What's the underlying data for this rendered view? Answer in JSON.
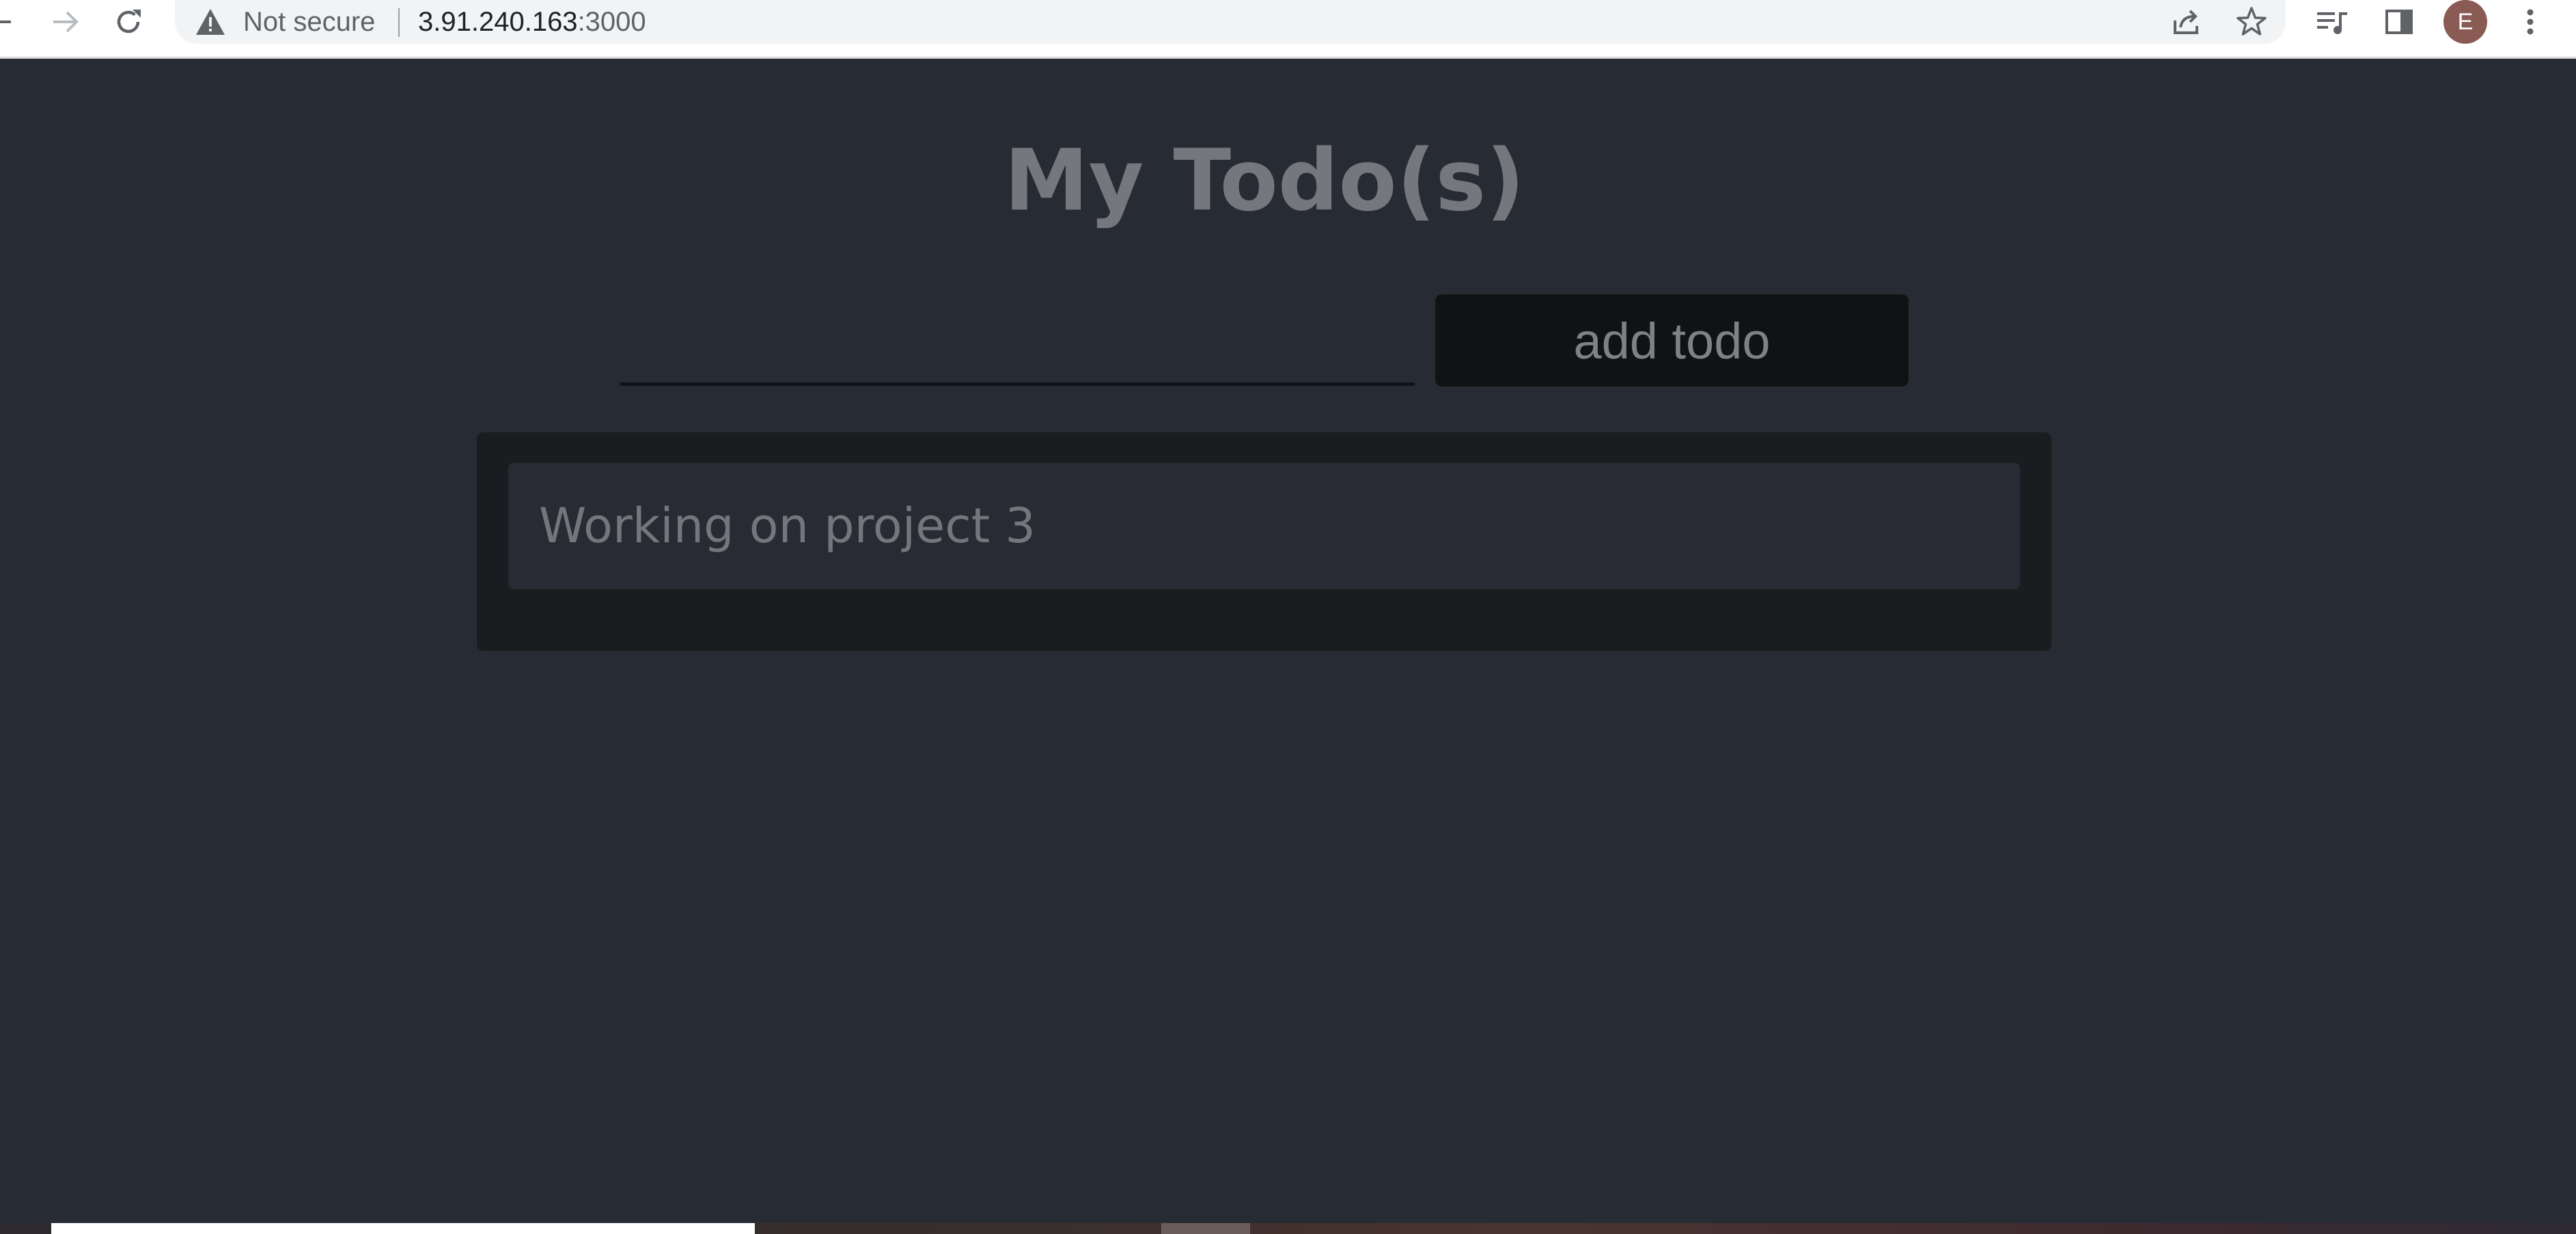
{
  "browser": {
    "security_label": "Not secure",
    "url_host": "3.91.240.163",
    "url_port": ":3000",
    "profile_initial": "E"
  },
  "page": {
    "title": "My Todo(s)",
    "input_value": "",
    "add_button_label": "add todo",
    "todos": [
      {
        "text": "Working on project 3"
      }
    ]
  },
  "icons": {
    "back": "back-arrow-icon",
    "forward": "forward-arrow-icon",
    "reload": "reload-icon",
    "warning": "warning-triangle-icon",
    "share": "share-icon",
    "bookmark": "star-icon",
    "reading_list": "reading-list-icon",
    "side_panel": "side-panel-icon",
    "menu": "kebab-menu-icon"
  },
  "colors": {
    "page_background": "#272b34",
    "list_background": "#1a1c20",
    "item_background": "#282b33",
    "button_background": "#111214",
    "text_muted": "#75777d",
    "avatar": "#8a5a54"
  }
}
